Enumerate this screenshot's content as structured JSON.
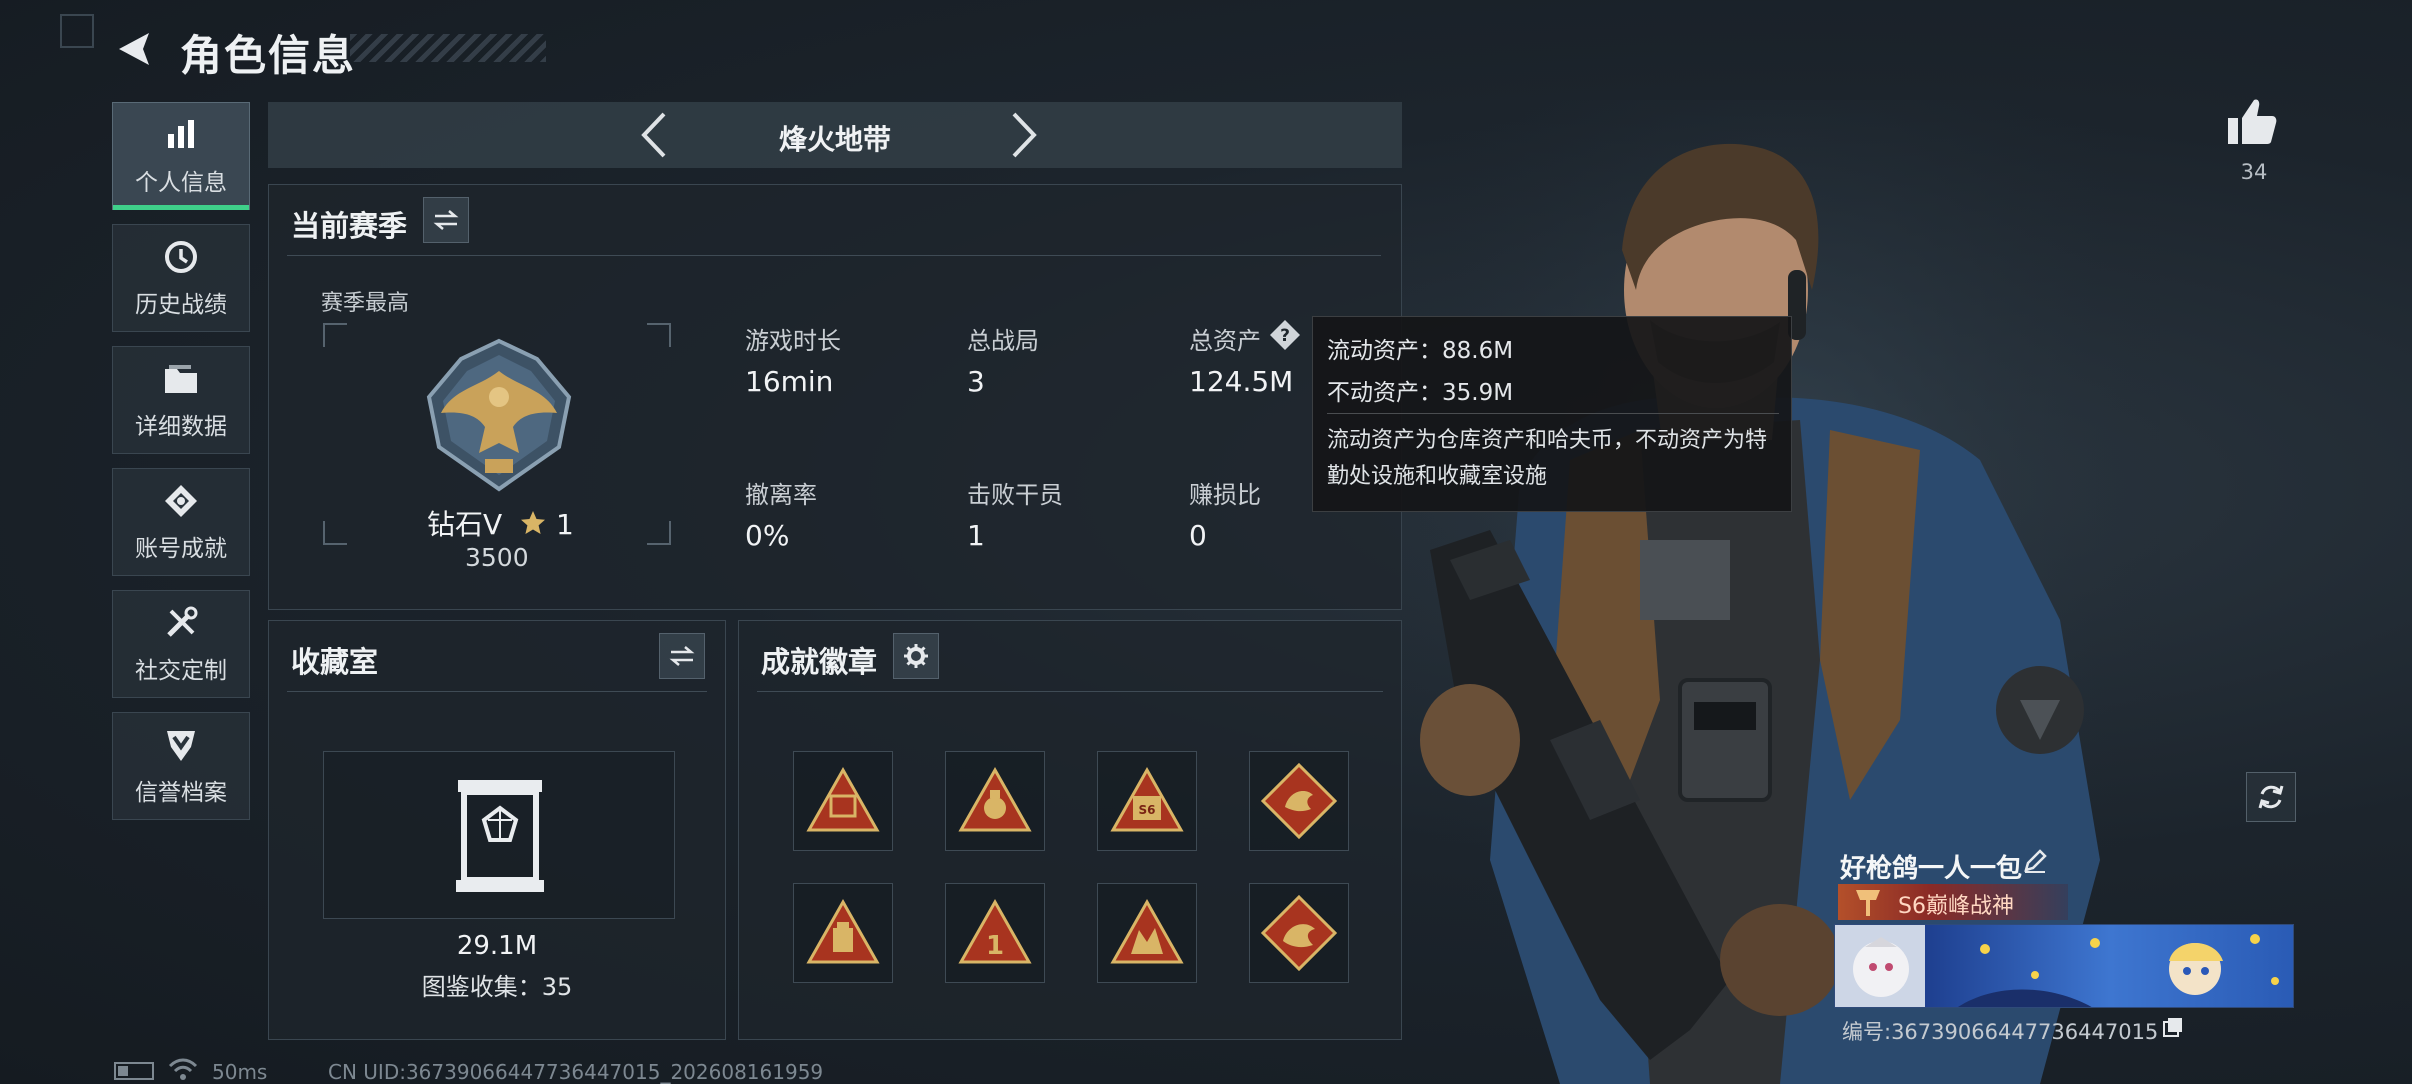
{
  "header": {
    "title": "角色信息"
  },
  "nav": {
    "items": [
      {
        "label": "个人信息",
        "icon": "bar-chart-icon",
        "active": true
      },
      {
        "label": "历史战绩",
        "icon": "history-clock-icon",
        "active": false
      },
      {
        "label": "详细数据",
        "icon": "folder-icon",
        "active": false
      },
      {
        "label": "账号成就",
        "icon": "achievement-badge-icon",
        "active": false
      },
      {
        "label": "社交定制",
        "icon": "tools-icon",
        "active": false
      },
      {
        "label": "信誉档案",
        "icon": "shield-rank-icon",
        "active": false
      }
    ]
  },
  "mode": {
    "title": "烽火地带"
  },
  "season": {
    "title": "当前赛季",
    "best_label": "赛季最高",
    "rank_name": "钻石V",
    "rank_stars": "1",
    "rank_points": "3500",
    "stats": [
      {
        "label": "游戏时长",
        "value": "16min"
      },
      {
        "label": "总战局",
        "value": "3"
      },
      {
        "label": "总资产",
        "value": "124.5M"
      },
      {
        "label": "撤离率",
        "value": "0%"
      },
      {
        "label": "击败干员",
        "value": "1"
      },
      {
        "label": "赚损比",
        "value": "0"
      }
    ]
  },
  "tooltip": {
    "liquid": "流动资产：88.6M",
    "fixed": "不动资产：35.9M",
    "description": "流动资产为仓库资产和哈夫币，不动资产为特勤处设施和收藏室设施"
  },
  "vault": {
    "title": "收藏室",
    "value": "29.1M",
    "collection": "图鉴收集：35"
  },
  "achievements": {
    "title": "成就徽章",
    "badges": [
      "achievement-badge-1",
      "achievement-badge-2",
      "achievement-badge-3",
      "achievement-badge-4",
      "achievement-badge-5",
      "achievement-badge-6",
      "achievement-badge-7",
      "achievement-badge-8"
    ]
  },
  "profile": {
    "likes": "34",
    "name": "好枪鸽一人一包",
    "rank_title": "S6巅峰战神",
    "id": "编号:3673906644773644701­5"
  },
  "status": {
    "ping": "50ms",
    "uid": "CN UID:3673906644773644701­5_202608161959"
  },
  "colors": {
    "accent": "#3fd08a",
    "gold": "#c9a25a",
    "badge_red": "#a8341f"
  }
}
